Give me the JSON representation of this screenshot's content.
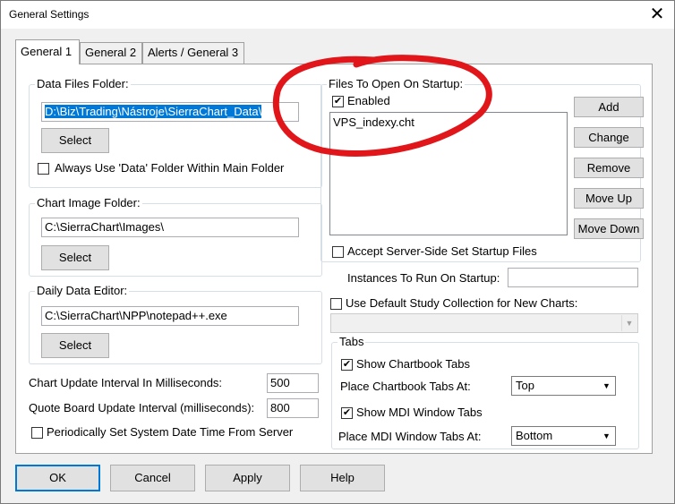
{
  "window": {
    "title": "General Settings",
    "close_glyph": "✕"
  },
  "tabs": [
    {
      "label": "General 1",
      "active": true
    },
    {
      "label": "General 2",
      "active": false
    },
    {
      "label": "Alerts / General 3",
      "active": false
    }
  ],
  "data_files": {
    "label": "Data Files Folder:",
    "value": "D:\\Biz\\Trading\\Nástroje\\SierraChart_Data\\",
    "select_label": "Select",
    "always_use_label": "Always Use 'Data' Folder Within Main Folder",
    "always_use_checked": false
  },
  "chart_image": {
    "label": "Chart Image Folder:",
    "value": "C:\\SierraChart\\Images\\",
    "select_label": "Select"
  },
  "daily_editor": {
    "label": "Daily Data Editor:",
    "value": "C:\\SierraChart\\NPP\\notepad++.exe",
    "select_label": "Select"
  },
  "chart_update": {
    "label": "Chart Update Interval In Milliseconds:",
    "value": "500"
  },
  "quote_update": {
    "label": "Quote Board Update Interval (milliseconds):",
    "value": "800"
  },
  "periodic_time": {
    "label": "Periodically Set System Date Time From Server",
    "checked": false
  },
  "files_startup": {
    "label": "Files To Open On Startup:",
    "enabled_label": "Enabled",
    "enabled_checked": true,
    "files": [
      "VPS_indexy.cht"
    ],
    "buttons": {
      "add": "Add",
      "change": "Change",
      "remove": "Remove",
      "move_up": "Move Up",
      "move_down": "Move Down"
    },
    "accept_server_label": "Accept Server-Side Set Startup Files",
    "accept_server_checked": false
  },
  "instances": {
    "label": "Instances To Run On Startup:",
    "value": ""
  },
  "default_study": {
    "label": "Use Default Study Collection for New Charts:",
    "checked": false,
    "value": ""
  },
  "tabs_group": {
    "label": "Tabs",
    "show_chartbook_label": "Show Chartbook Tabs",
    "show_chartbook_checked": true,
    "place_chartbook_label": "Place Chartbook Tabs At:",
    "place_chartbook_value": "Top",
    "show_mdi_label": "Show MDI Window Tabs",
    "show_mdi_checked": true,
    "place_mdi_label": "Place MDI Window Tabs At:",
    "place_mdi_value": "Bottom"
  },
  "footer": {
    "ok": "OK",
    "cancel": "Cancel",
    "apply": "Apply",
    "help": "Help"
  },
  "check_glyph": "✔",
  "dropdown_glyph": "▼",
  "annotation": {
    "color": "#e0161b",
    "shape": "hand-drawn-ellipse"
  }
}
